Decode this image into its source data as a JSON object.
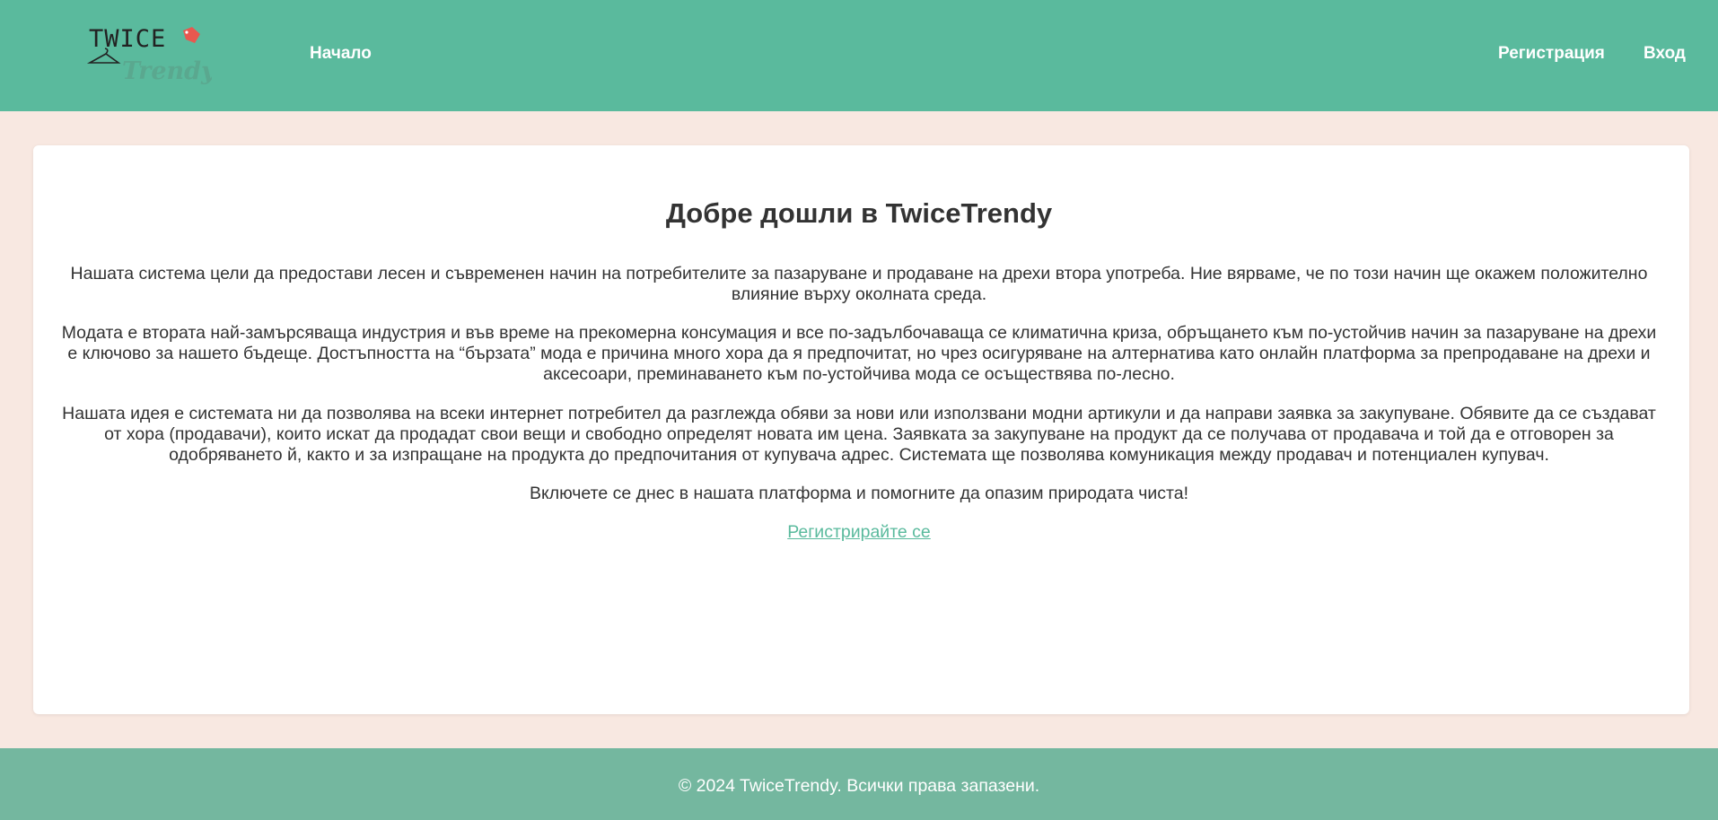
{
  "header": {
    "logo": {
      "top_text": "TWICE",
      "bottom_text": "Trendy",
      "tag_color": "#e8584f",
      "hanger_icon": "hanger-icon"
    },
    "nav": {
      "home": "Начало",
      "register": "Регистрация",
      "login": "Вход"
    }
  },
  "main": {
    "title": "Добре дошли в TwiceTrendy",
    "paragraphs": [
      "Нашата система цели да предостави лесен и съвременен начин на потребителите за пазаруване и продаване на дрехи втора употреба. Ние вярваме, че по този начин ще окажем положително влияние върху околната среда.",
      "Модата е втората най-замърсяваща индустрия и във време на прекомерна консумация и все по-задълбочаваща се климатична криза, обръщането към по-устойчив начин за пазаруване на дрехи е ключово за нашето бъдеще. Достъпността на “бързата” мода е причина много хора да я предпочитат, но чрез осигуряване на алтернатива като онлайн платформа за препродаване на дрехи и аксесоари, преминаването към по-устойчива мода се осъществява по-лесно.",
      "Нашата идея е системата ни да позволява на всеки интернет потребител да разглежда обяви за нови или използвани модни артикули и да направи заявка за закупуване. Обявите да се създават от хора (продавачи), които искат да продадат свои вещи и свободно определят новата им цена. Заявката за закупуване на продукт да се получава от продавача и той да е отговорен за одобряването й, както и за изпращане на продукта до предпочитания от купувача адрес. Системата ще позволява комуникация между продавач и потенциален купувач.",
      "Включете се днес в нашата платформа и помогните да опазим природата чиста!"
    ],
    "cta_link": "Регистрирайте се"
  },
  "footer": {
    "text": "© 2024 TwiceTrendy. Всички права запазени."
  },
  "colors": {
    "header_bg": "#5aba9d",
    "page_bg": "#f8e8e1",
    "footer_bg": "#74b79f",
    "link": "#5aba9d"
  }
}
